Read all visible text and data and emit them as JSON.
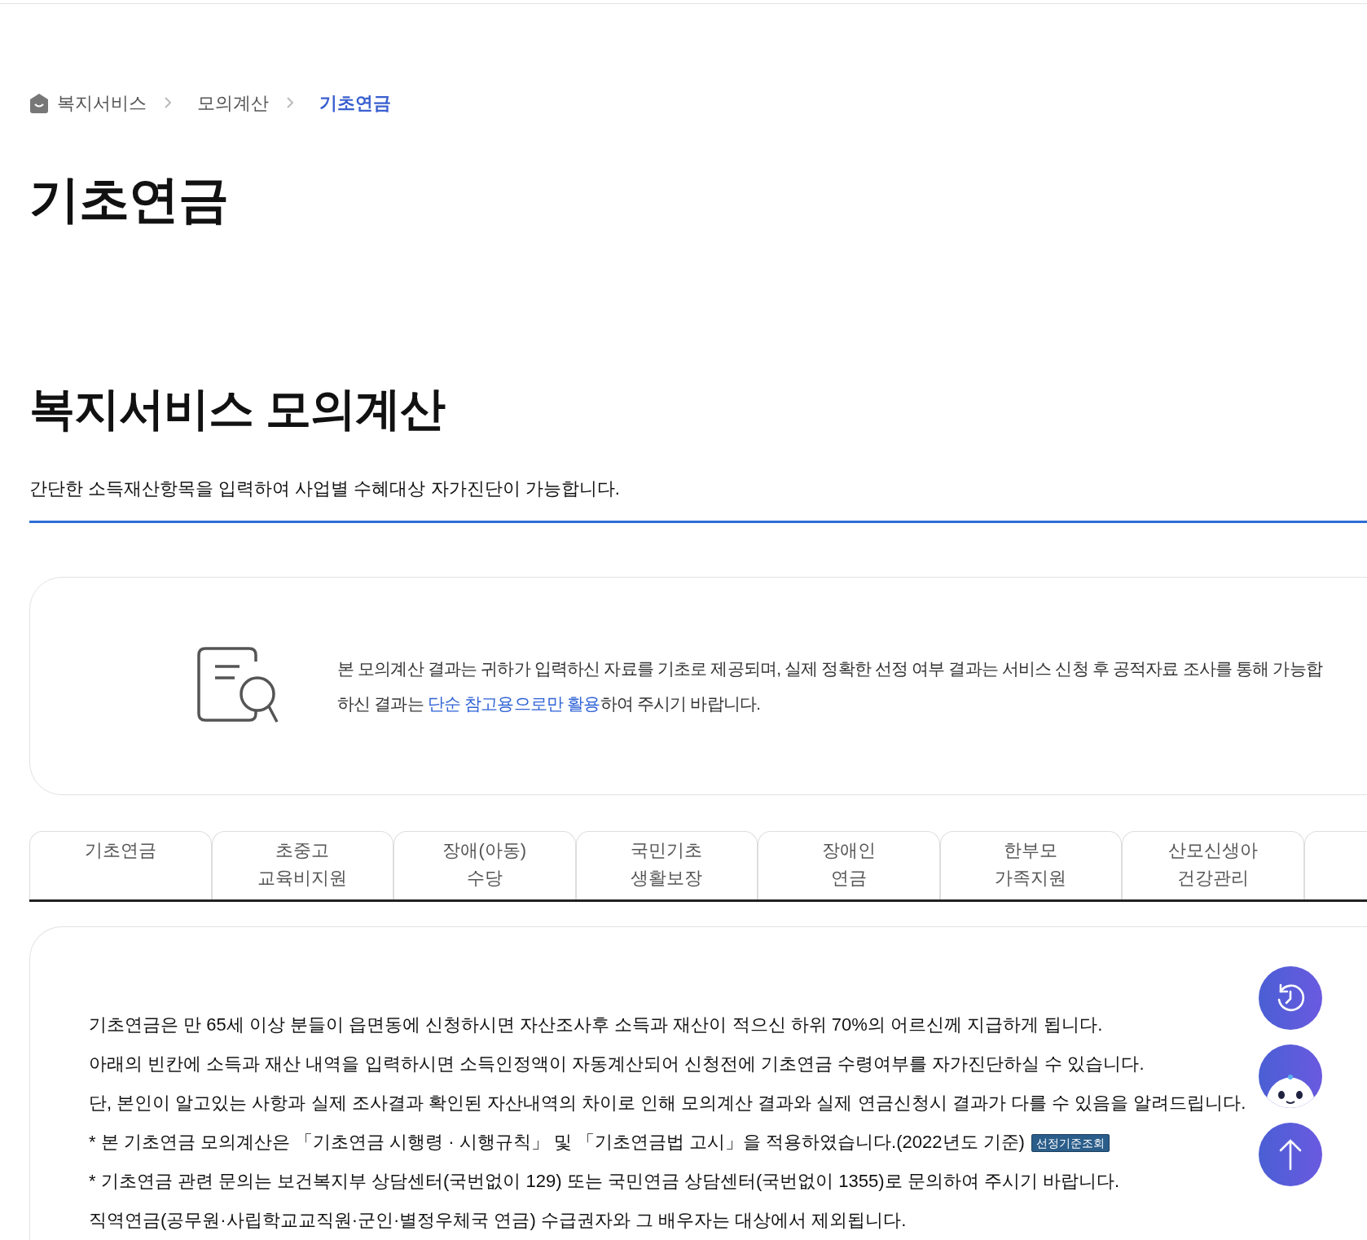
{
  "breadcrumb": [
    {
      "label": "복지서비스",
      "current": false
    },
    {
      "label": "모의계산",
      "current": false
    },
    {
      "label": "기초연금",
      "current": true
    }
  ],
  "page_title": "기초연금",
  "section": {
    "title": "복지서비스 모의계산",
    "subtitle": "간단한 소득재산항목을 입력하여 사업별 수혜대상 자가진단이 가능합니다."
  },
  "notice": {
    "line_1": "본 모의계산 결과는 귀하가 입력하신 자료를 기초로 제공되며, 실제 정확한 선정 여부 결과는 서비스 신청 후 공적자료 조사를 통해 가능합",
    "line_2_before": "하신 결과는 ",
    "line_2_link": "단순 참고용으로만 활용",
    "line_2_after": "하여 주시기 바랍니다."
  },
  "tabs": [
    {
      "label": "기초연금"
    },
    {
      "label": "초중고\n교육비지원"
    },
    {
      "label": "장애(아동)\n수당"
    },
    {
      "label": "국민기초\n생활보장"
    },
    {
      "label": "장애인\n연금"
    },
    {
      "label": "한부모\n가족지원"
    },
    {
      "label": "산모신생아\n건강관리"
    }
  ],
  "description": [
    {
      "text": "기초연금은 만 65세 이상 분들이 읍면동에 신청하시면 자산조사후 소득과 재산이 적으신 하위 70%의 어르신께 지급하게 됩니다."
    },
    {
      "text": "아래의 빈칸에 소득과 재산 내역을 입력하시면 소득인정액이 자동계산되어 신청전에 기초연금 수령여부를 자가진단하실 수 있습니다."
    },
    {
      "text": "단, 본인이 알고있는 사항과 실제 조사결과 확인된 자산내역의 차이로 인해 모의계산 결과와 실제 연금신청시 결과가 다를 수 있음을 알려드립니다."
    },
    {
      "text": "* 본 기초연금 모의계산은 「기초연금 시행령 · 시행규칙」 및 「기초연금법 고시」을 적용하였습니다.(2022년도 기준)",
      "badge": "선정기준조회"
    },
    {
      "text": "* 기초연금 관련 문의는 보건복지부 상담센터(국번없이 129) 또는 국민연금 상담센터(국번없이 1355)로 문의하여 주시기 바랍니다."
    },
    {
      "text": "직역연금(공무원·사립학교교직원·군인·별정우체국 연금) 수급권자와 그 배우자는 대상에서 제외됩니다."
    }
  ]
}
